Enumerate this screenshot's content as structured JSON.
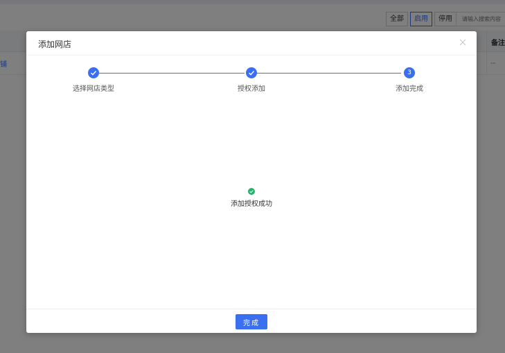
{
  "background": {
    "filters": [
      "全部",
      "启用",
      "停用"
    ],
    "active_filter": 1,
    "search_placeholder": "请输入搜索内容",
    "table_header_note": "备注",
    "row_link_text": "铺",
    "row_note": "--"
  },
  "modal": {
    "title": "添加网店",
    "steps": [
      {
        "label": "选择网店类型",
        "status": "done"
      },
      {
        "label": "授权添加",
        "status": "done"
      },
      {
        "label": "添加完成",
        "status": "current",
        "number": "3"
      }
    ],
    "success_text": "添加授权成功",
    "done_label": "完成"
  },
  "colors": {
    "accent": "#3a6ff0",
    "success": "#27b36a"
  }
}
